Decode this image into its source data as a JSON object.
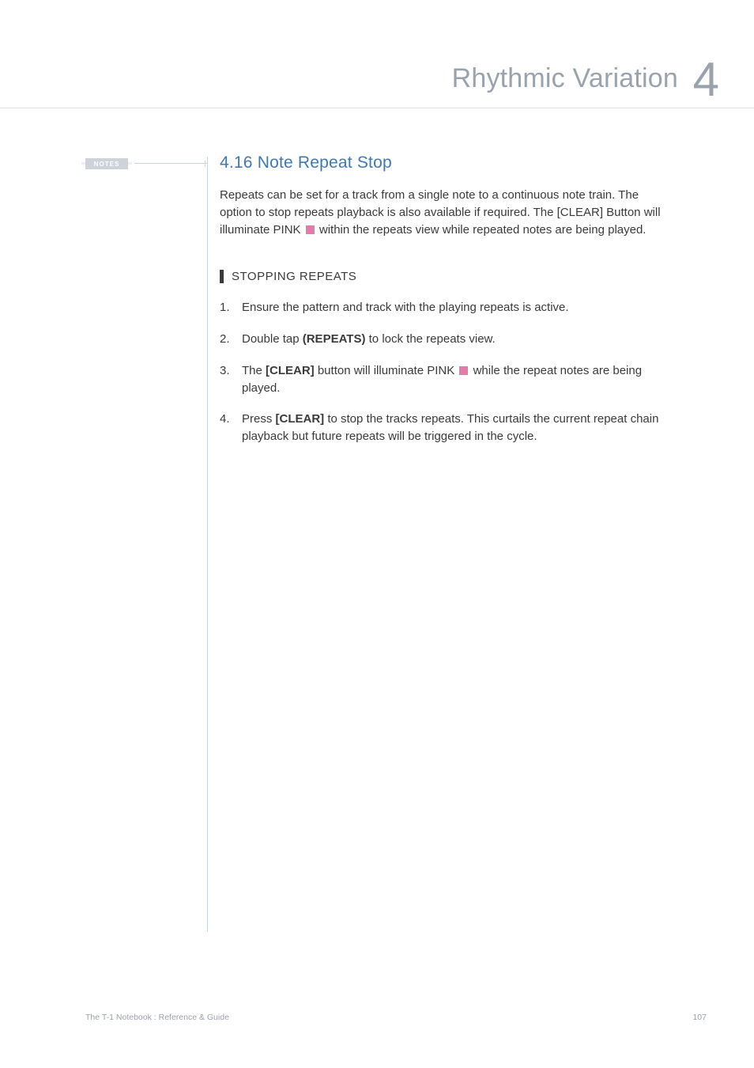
{
  "header": {
    "title": "Rhythmic Variation",
    "chapter": "4"
  },
  "notes_tab": "NOTES",
  "section": {
    "title": "4.16 Note Repeat Stop",
    "intro_parts": {
      "p1": "Repeats can be set for a track from a single note to a continuous note train. The option to stop repeats playback is also available if required. The [CLEAR] Button will illuminate PINK ",
      "p2": " within the repeats view while repeated notes are being played."
    },
    "sub_title": "STOPPING REPEATS",
    "steps": {
      "s1": "Ensure the pattern and track with the playing repeats is active.",
      "s2a": "Double tap ",
      "s2b": "(REPEATS)",
      "s2c": " to lock the repeats view.",
      "s3a": "The ",
      "s3b": "[CLEAR]",
      "s3c": " button will illuminate PINK ",
      "s3d": " while the repeat notes are being played.",
      "s4a": "Press ",
      "s4b": "[CLEAR]",
      "s4c": " to stop the tracks repeats. This curtails the current repeat chain playback but future repeats will be triggered in the cycle."
    }
  },
  "footer": {
    "left": "The T-1 Notebook : Reference & Guide",
    "right": "107"
  }
}
